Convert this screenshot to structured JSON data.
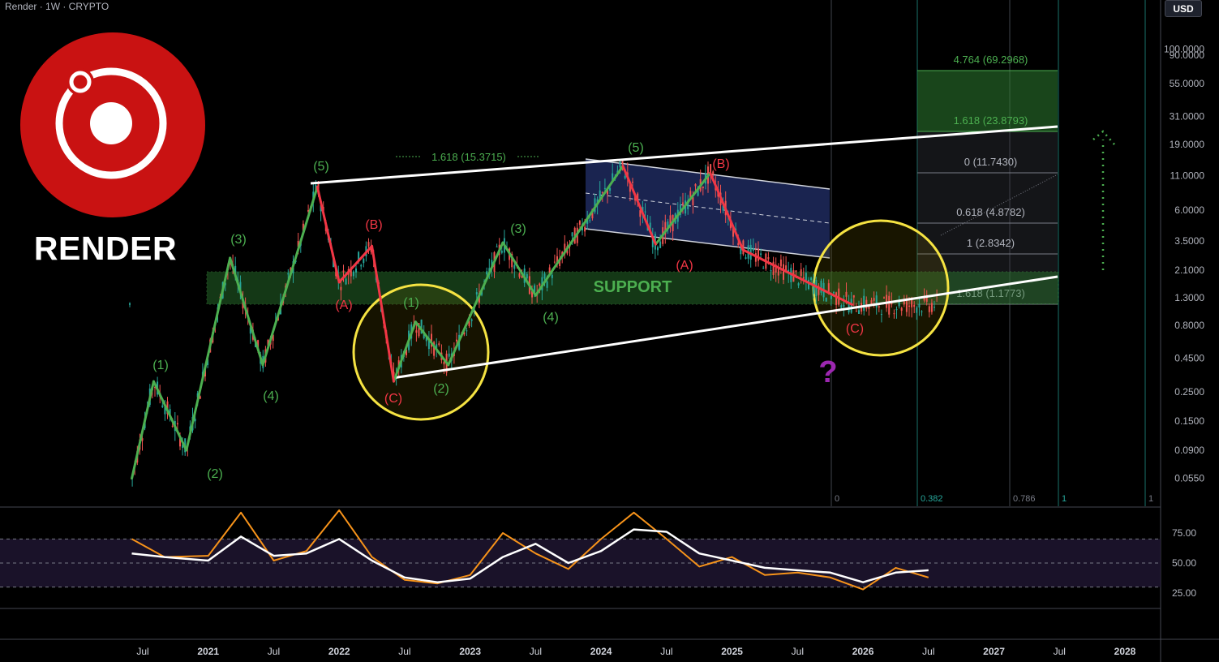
{
  "header": {
    "symbol_label": "Render · 1W · CRYPTO",
    "currency_button": "USD"
  },
  "logo": {
    "ticker": "RENDER",
    "color": "#c91212"
  },
  "colors": {
    "bull": "#26a69a",
    "bear": "#ef5350",
    "impulse_wave": "#4caf50",
    "corrective_wave": "#f23645",
    "trendline": "#ffffff",
    "support_zone": "#4caf50",
    "circle": "#f5e342",
    "channel": "#1e2a5e",
    "rsi": "#f7931a",
    "rsi_ma": "#ffffff",
    "question": "#9c27b0"
  },
  "price_axis": {
    "labels": [
      "100.0000",
      "90.0000",
      "55.0000",
      "31.0000",
      "19.0000",
      "11.0000",
      "6.0000",
      "3.5000",
      "2.1000",
      "1.3000",
      "0.8000",
      "0.4500",
      "0.2500",
      "0.1500",
      "0.0900",
      "0.0550"
    ]
  },
  "rsi_axis": {
    "labels": [
      "75.00",
      "50.00",
      "25.00"
    ]
  },
  "time_axis": {
    "labels": [
      "Jul",
      "2021",
      "Jul",
      "2022",
      "Jul",
      "2023",
      "Jul",
      "2024",
      "Jul",
      "2025",
      "Jul",
      "2026",
      "Jul",
      "2027",
      "Jul",
      "2028"
    ]
  },
  "annotations": {
    "support": "SUPPORT",
    "fib_extension": "1.618 (15.3715)",
    "question": "?",
    "waves": [
      {
        "label": "(1)",
        "type": "impulse"
      },
      {
        "label": "(2)",
        "type": "impulse"
      },
      {
        "label": "(3)",
        "type": "impulse"
      },
      {
        "label": "(4)",
        "type": "impulse"
      },
      {
        "label": "(5)",
        "type": "impulse"
      },
      {
        "label": "(A)",
        "type": "corrective"
      },
      {
        "label": "(B)",
        "type": "corrective"
      },
      {
        "label": "(C)",
        "type": "corrective"
      },
      {
        "label": "(1)",
        "type": "impulse"
      },
      {
        "label": "(2)",
        "type": "impulse"
      },
      {
        "label": "(3)",
        "type": "impulse"
      },
      {
        "label": "(4)",
        "type": "impulse"
      },
      {
        "label": "(5)",
        "type": "impulse"
      },
      {
        "label": "(A)",
        "type": "corrective"
      },
      {
        "label": "(B)",
        "type": "corrective"
      },
      {
        "label": "(C)",
        "type": "corrective"
      }
    ]
  },
  "fib_levels": [
    {
      "label": "4.764 (69.2968)",
      "color": "#4caf50"
    },
    {
      "label": "1.618 (23.8793)",
      "color": "#4caf50"
    },
    {
      "label": "0 (11.7430)",
      "color": "#b2b5be"
    },
    {
      "label": "0.618 (4.8782)",
      "color": "#b2b5be"
    },
    {
      "label": "1 (2.8342)",
      "color": "#b2b5be"
    },
    {
      "label": "1.618 (1.1773)",
      "color": "#b2b5be"
    }
  ],
  "fib_time_labels": [
    "0",
    "0.382",
    "0.786",
    "1",
    "1"
  ],
  "chart_data": {
    "type": "line",
    "title": "",
    "xlabel": "",
    "ylabel": "",
    "y_scale": "log",
    "ylim": [
      0.045,
      110
    ],
    "grid": false,
    "series": [
      {
        "x": [
          "2020-06",
          "2020-08",
          "2020-11",
          "2021-03",
          "2021-06",
          "2021-11",
          "2022-01",
          "2022-04",
          "2022-06",
          "2022-08",
          "2022-11",
          "2023-04",
          "2023-07",
          "2024-03",
          "2024-06",
          "2024-11",
          "2025-02",
          "2025-12"
        ],
        "values": [
          0.055,
          0.3,
          0.09,
          2.6,
          0.4,
          9.0,
          1.7,
          3.2,
          0.3,
          0.85,
          0.4,
          3.4,
          1.35,
          13.0,
          3.3,
          11.5,
          3.0,
          1.15
        ]
      }
    ],
    "rsi": {
      "ylim": [
        0,
        100
      ],
      "levels": [
        70,
        50,
        30
      ],
      "x": [
        "2020-06",
        "2020-09",
        "2021-01",
        "2021-04",
        "2021-07",
        "2021-10",
        "2022-01",
        "2022-04",
        "2022-07",
        "2022-10",
        "2023-01",
        "2023-04",
        "2023-07",
        "2023-10",
        "2024-01",
        "2024-04",
        "2024-07",
        "2024-10",
        "2025-01",
        "2025-04",
        "2025-07",
        "2025-10",
        "2026-01",
        "2026-04",
        "2026-07"
      ],
      "rsi": [
        70,
        55,
        56,
        92,
        52,
        60,
        94,
        55,
        36,
        33,
        40,
        75,
        58,
        45,
        70,
        92,
        70,
        47,
        55,
        40,
        42,
        38,
        28,
        46,
        38
      ],
      "rsi_ma": [
        58,
        55,
        52,
        72,
        56,
        58,
        70,
        52,
        38,
        34,
        37,
        55,
        66,
        50,
        60,
        78,
        76,
        58,
        52,
        46,
        44,
        42,
        34,
        42,
        44
      ]
    }
  }
}
